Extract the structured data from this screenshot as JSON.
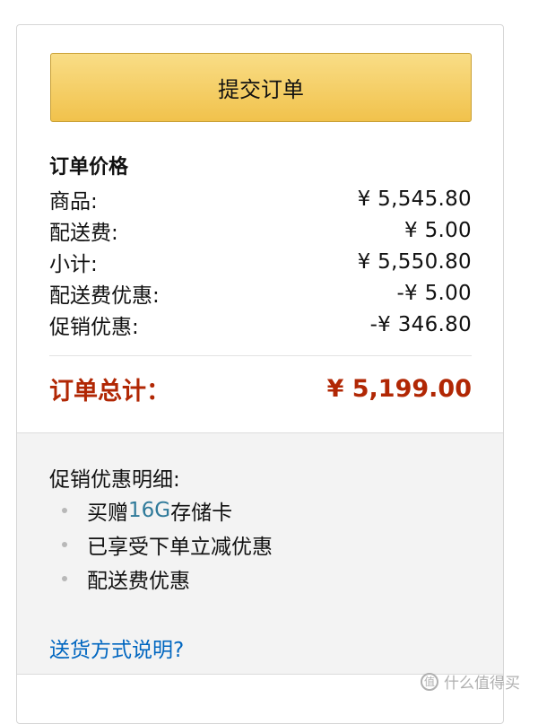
{
  "submit": {
    "label": "提交订单"
  },
  "summary": {
    "title": "订单价格",
    "rows": [
      {
        "label": "商品:",
        "value": "¥ 5,545.80"
      },
      {
        "label": "配送费:",
        "value": "¥ 5.00"
      },
      {
        "label": "小计:",
        "value": "¥ 5,550.80"
      },
      {
        "label": "配送费优惠:",
        "value": "-¥ 5.00"
      },
      {
        "label": "促销优惠:",
        "value": "-¥ 346.80"
      }
    ],
    "total_label": "订单总计：",
    "total_value": "¥ 5,199.00"
  },
  "promotions": {
    "title": "促销优惠明细:",
    "items": [
      {
        "pre": "买赠",
        "highlight": "16G",
        "post": "存储卡"
      },
      {
        "pre": "已享受下单立减优惠",
        "highlight": "",
        "post": ""
      },
      {
        "pre": "配送费优惠",
        "highlight": "",
        "post": ""
      }
    ],
    "shipping_link": "送货方式说明?"
  },
  "watermark": {
    "text": "什么值得买",
    "icon": "zhi-icon",
    "icon_glyph": "值"
  },
  "colors": {
    "button": "#f1c24c",
    "total": "#b12704",
    "link": "#0066c0",
    "highlight": "#2f7a9a"
  }
}
